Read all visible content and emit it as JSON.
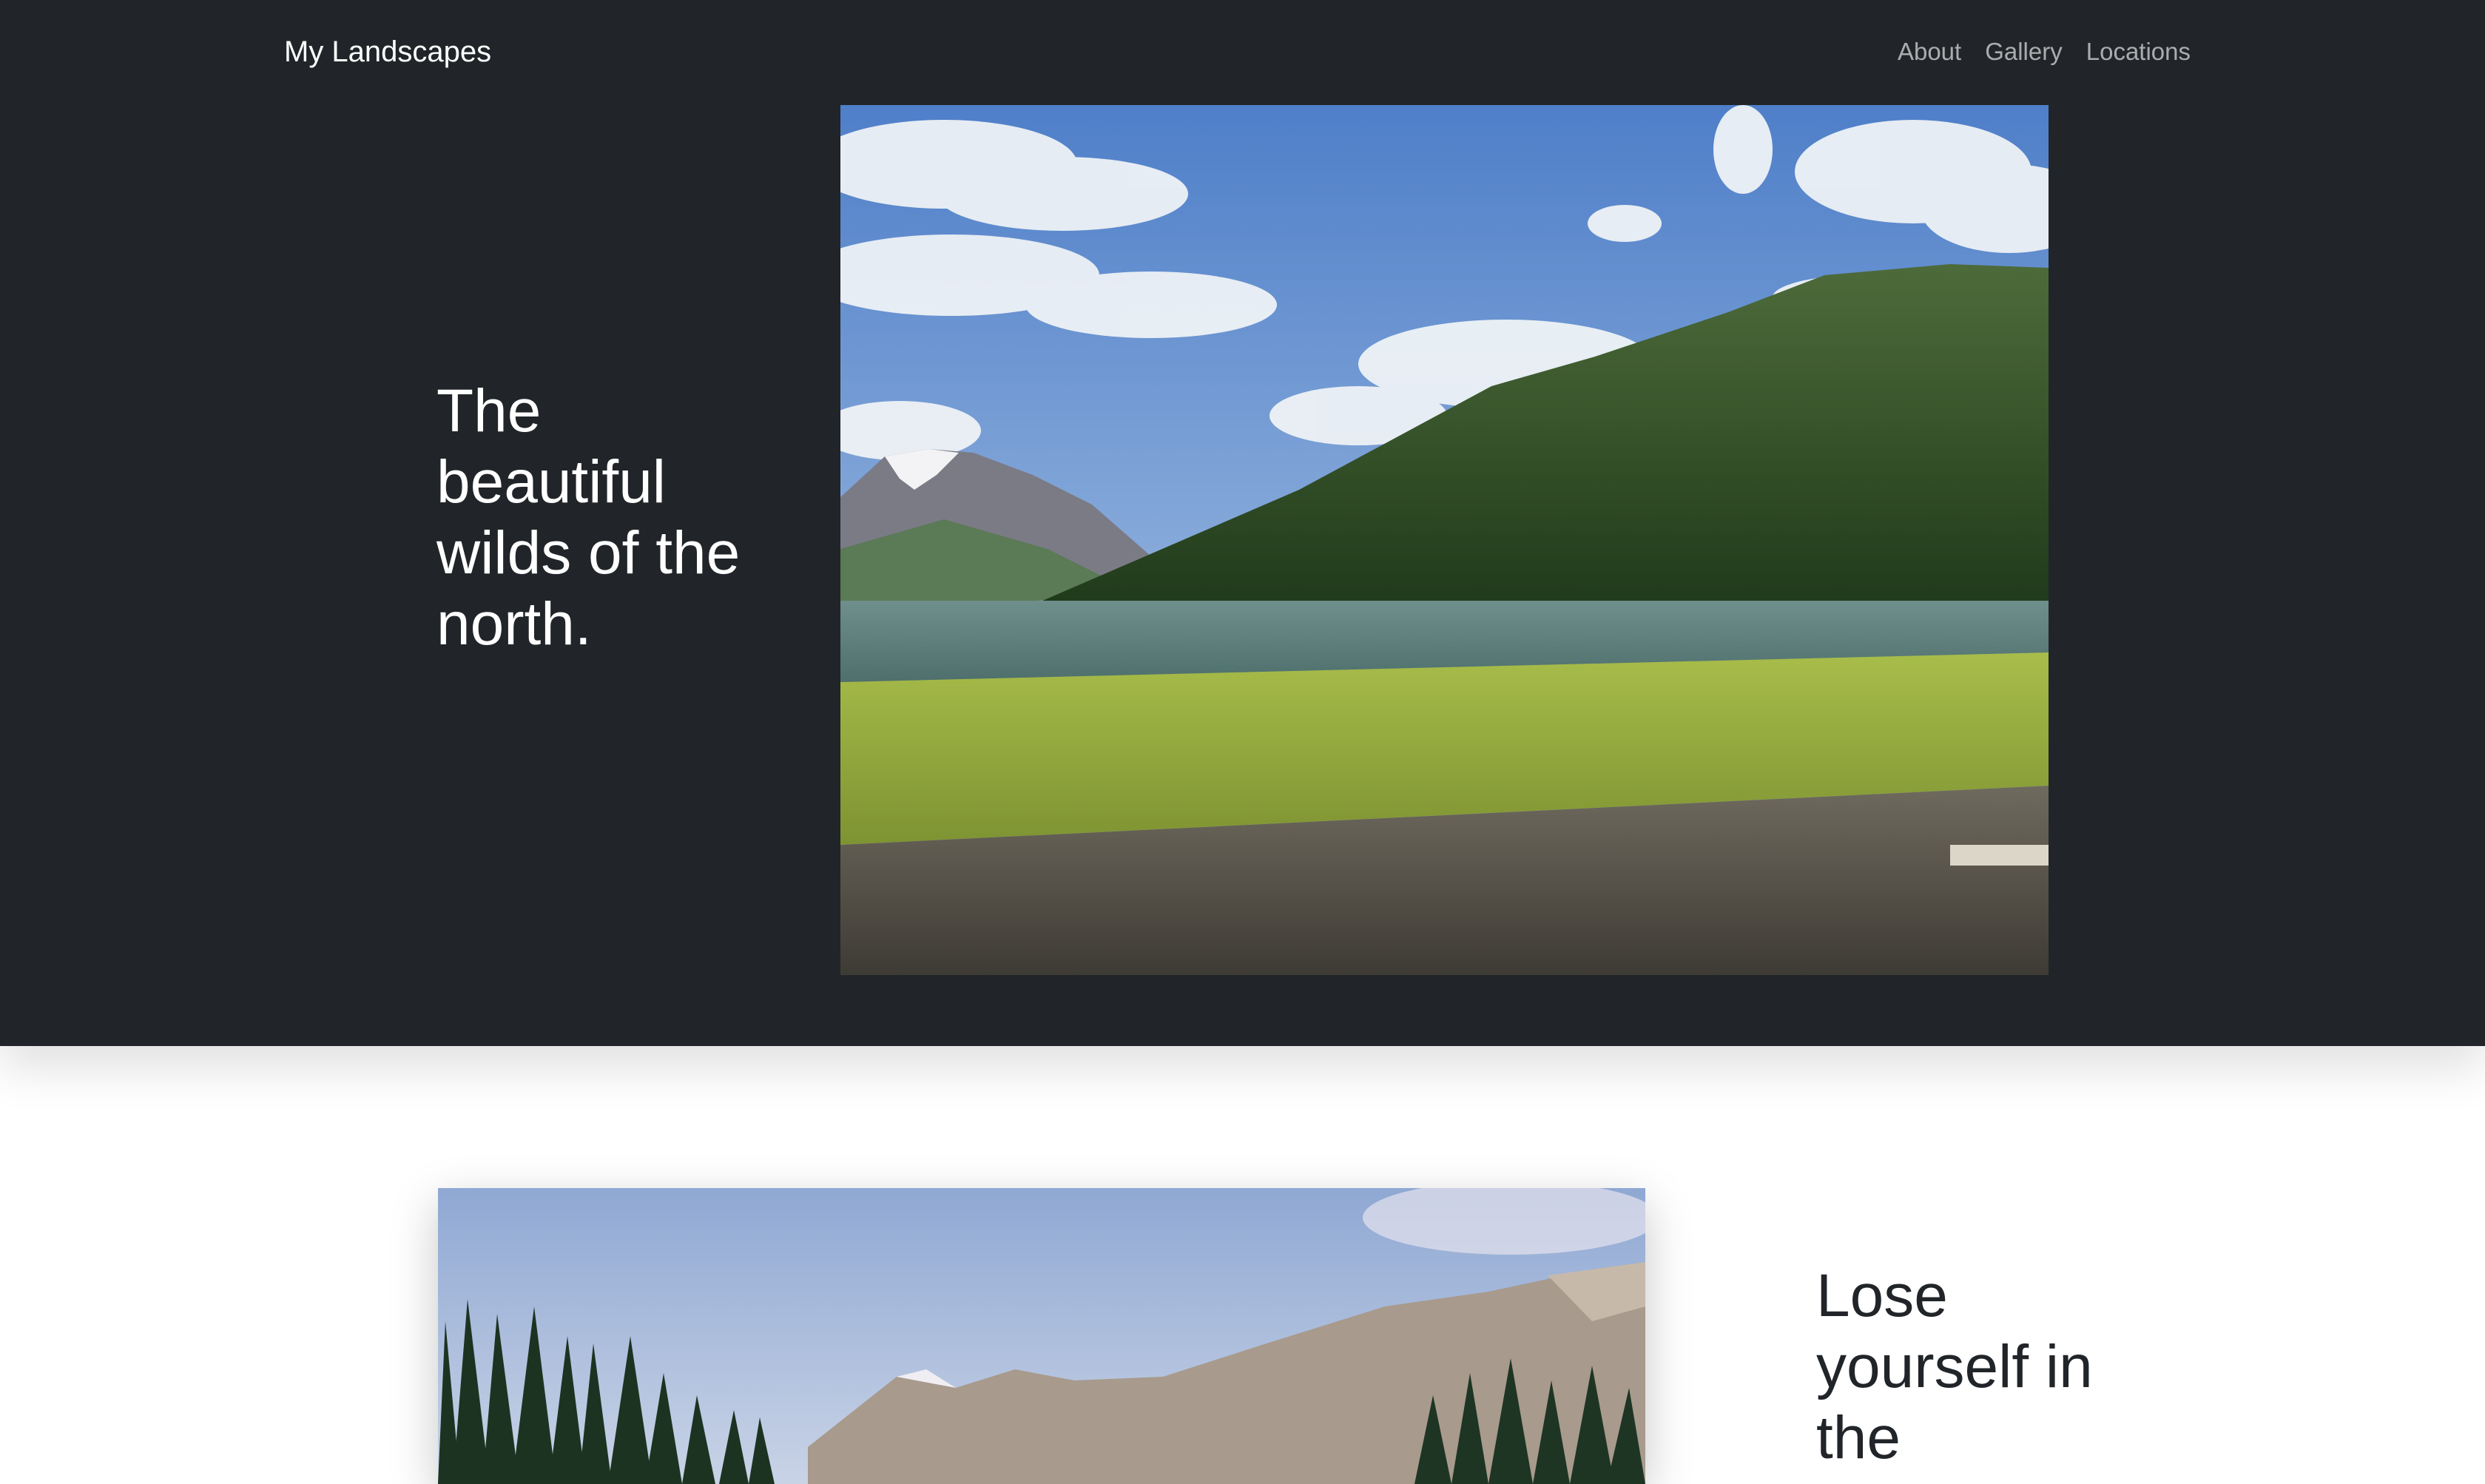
{
  "navbar": {
    "brand": "My Landscapes",
    "links": [
      "About",
      "Gallery",
      "Locations"
    ]
  },
  "hero": {
    "heading": "The beautiful wilds of the north.",
    "photo": "lake-mountain-meadow-photo"
  },
  "second_section": {
    "heading": "Lose yourself in the",
    "photo": "forest-mountain-range-photo"
  },
  "colors": {
    "dark_background": "#212529",
    "light_background": "#ffffff",
    "nav_link": "rgba(255,255,255,0.62)"
  }
}
